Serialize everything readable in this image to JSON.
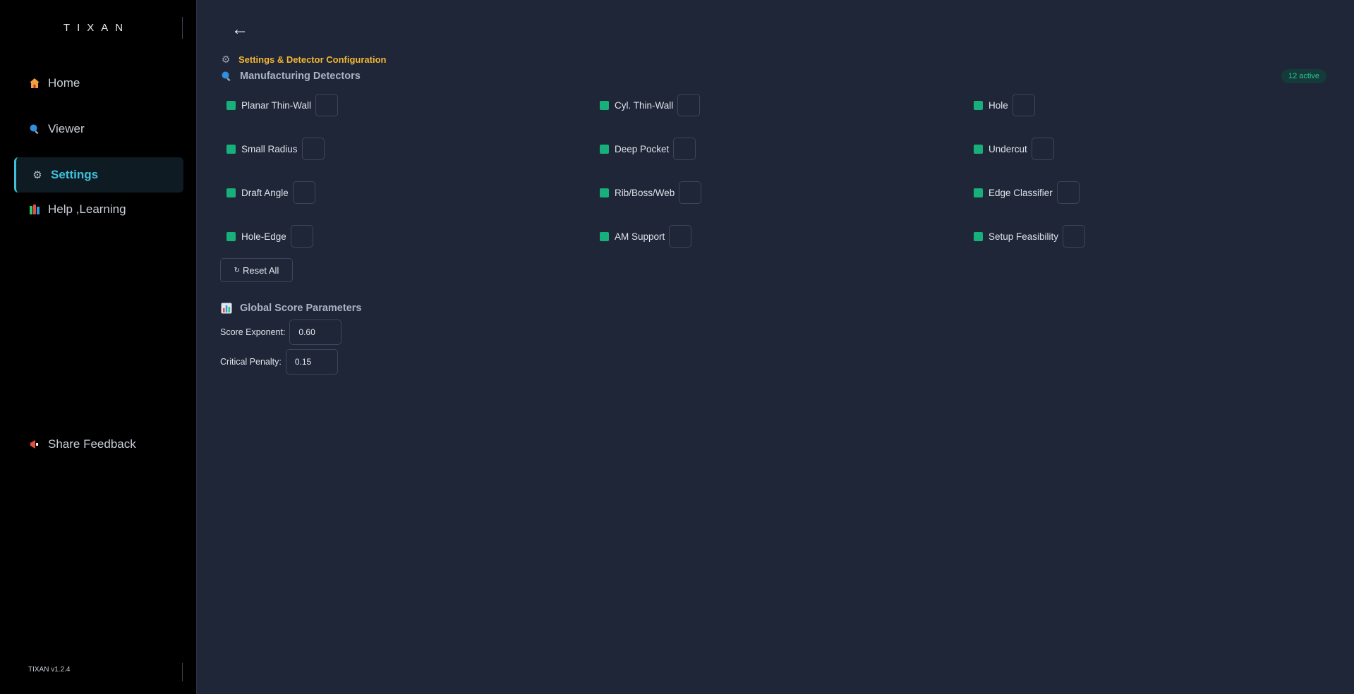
{
  "brand": "TIXAN",
  "version": "TIXAN v1.2.4",
  "sidebar": {
    "items": [
      {
        "label": "Home",
        "icon": "home-icon"
      },
      {
        "label": "Viewer",
        "icon": "magnifier-icon"
      },
      {
        "label": "Settings",
        "icon": "gear-icon",
        "active": true
      },
      {
        "label": "Help ,Learning",
        "icon": "books-icon"
      }
    ],
    "feedback": {
      "label": "Share Feedback",
      "icon": "megaphone-icon"
    }
  },
  "header": {
    "back": "←",
    "breadcrumb": "Settings & Detector Configuration"
  },
  "detectors": {
    "title": "Manufacturing Detectors",
    "badge": "12 active",
    "items": [
      "Planar Thin-Wall",
      "Cyl. Thin-Wall",
      "Hole",
      "Small Radius",
      "Deep Pocket",
      "Undercut",
      "Draft Angle",
      "Rib/Boss/Web",
      "Edge Classifier",
      "Hole-Edge",
      "AM Support",
      "Setup Feasibility"
    ],
    "reset_label": "Reset All"
  },
  "global_params": {
    "title": "Global Score Parameters",
    "score_exponent_label": "Score Exponent:",
    "score_exponent_value": "0.60",
    "critical_penalty_label": "Critical Penalty:",
    "critical_penalty_value": "0.15"
  },
  "colors": {
    "accent": "#3fc1dc",
    "breadcrumb": "#f5b731",
    "check": "#17b07a",
    "background": "#1e2637",
    "sidebar": "#000000"
  }
}
